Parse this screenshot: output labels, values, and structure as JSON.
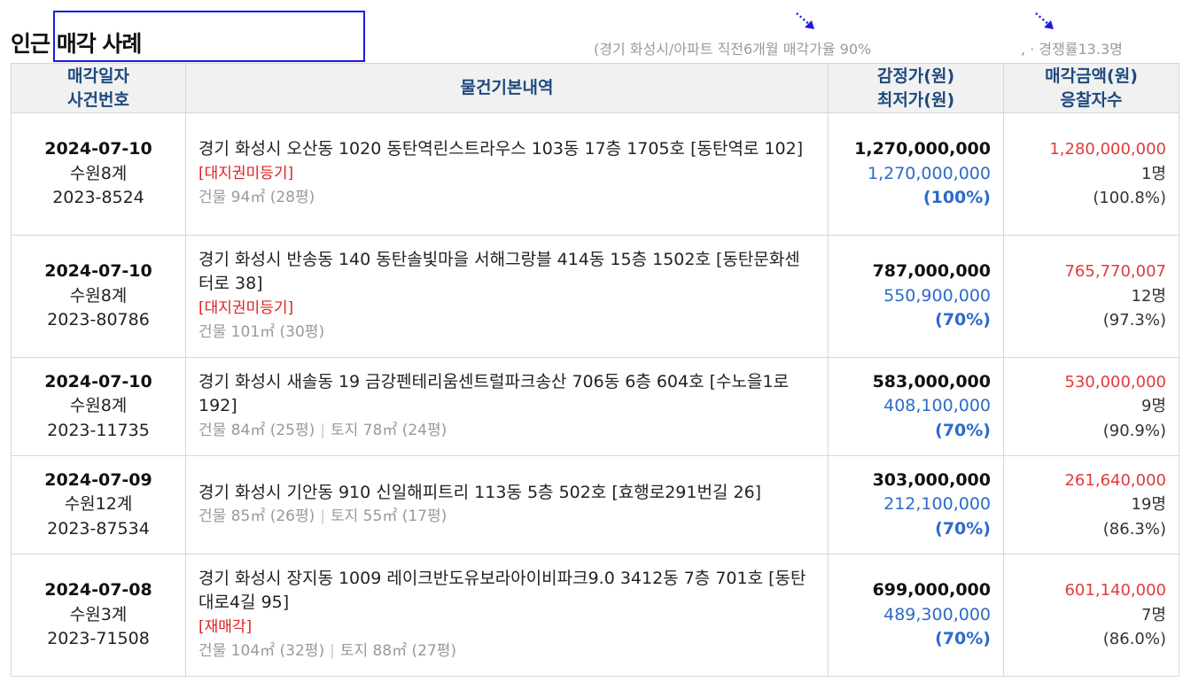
{
  "header": {
    "title": "인근 매각 사례",
    "summary_left": "(경기 화성시/아파트 직전6개월 매각가율 90%",
    "summary_right": ", · 경쟁률13.3명"
  },
  "table": {
    "columns": {
      "date_line1": "매각일자",
      "date_line2": "사건번호",
      "desc": "물건기본내역",
      "price_line1": "감정가(원)",
      "price_line2": "최저가(원)",
      "sale_line1": "매각금액(원)",
      "sale_line2": "응찰자수"
    },
    "rows": [
      {
        "date": "2024-07-10",
        "court": "수원8계",
        "case": "2023-8524",
        "address": "경기 화성시 오산동 1020 동탄역린스트라우스 103동 17층 1705호 [동탄역로 102]",
        "tag": "[대지권미등기]",
        "building": "건물 94㎡ (28평)",
        "land": "",
        "appraisal": "1,270,000,000",
        "minimum": "1,270,000,000",
        "min_pct": "(100%)",
        "sale_price": "1,280,000,000",
        "bidders": "1명",
        "sale_pct": "(100.8%)"
      },
      {
        "date": "2024-07-10",
        "court": "수원8계",
        "case": "2023-80786",
        "address": "경기 화성시 반송동 140 동탄솔빛마을 서해그랑블 414동 15층 1502호 [동탄문화센터로 38]",
        "tag": "[대지권미등기]",
        "building": "건물 101㎡ (30평)",
        "land": "",
        "appraisal": "787,000,000",
        "minimum": "550,900,000",
        "min_pct": "(70%)",
        "sale_price": "765,770,007",
        "bidders": "12명",
        "sale_pct": "(97.3%)"
      },
      {
        "date": "2024-07-10",
        "court": "수원8계",
        "case": "2023-11735",
        "address": "경기 화성시 새솔동 19 금강펜테리움센트럴파크송산 706동 6층 604호 [수노을1로 192]",
        "tag": "",
        "building": "건물 84㎡ (25평)",
        "land": "토지 78㎡ (24평)",
        "appraisal": "583,000,000",
        "minimum": "408,100,000",
        "min_pct": "(70%)",
        "sale_price": "530,000,000",
        "bidders": "9명",
        "sale_pct": "(90.9%)"
      },
      {
        "date": "2024-07-09",
        "court": "수원12계",
        "case": "2023-87534",
        "address": "경기 화성시 기안동 910 신일해피트리 113동 5층 502호 [효행로291번길 26]",
        "tag": "",
        "building": "건물 85㎡ (26평)",
        "land": "토지 55㎡ (17평)",
        "appraisal": "303,000,000",
        "minimum": "212,100,000",
        "min_pct": "(70%)",
        "sale_price": "261,640,000",
        "bidders": "19명",
        "sale_pct": "(86.3%)"
      },
      {
        "date": "2024-07-08",
        "court": "수원3계",
        "case": "2023-71508",
        "address": "경기 화성시 장지동 1009 레이크반도유보라아이비파크9.0 3412동 7층 701호 [동탄대로4길 95]",
        "tag": "[재매각]",
        "building": "건물 104㎡ (32평)",
        "land": "토지 88㎡ (27평)",
        "appraisal": "699,000,000",
        "minimum": "489,300,000",
        "min_pct": "(70%)",
        "sale_price": "601,140,000",
        "bidders": "7명",
        "sale_pct": "(86.0%)"
      }
    ]
  },
  "colors": {
    "header_text": "#1e4a7e",
    "minimum_price": "#2d6bc8",
    "sale_price": "#e03b3b",
    "tag": "#e02020",
    "highlight_box": "#1a1ae6"
  },
  "icons": [
    "dotted-arrow-icon",
    "dotted-arrow-icon"
  ]
}
